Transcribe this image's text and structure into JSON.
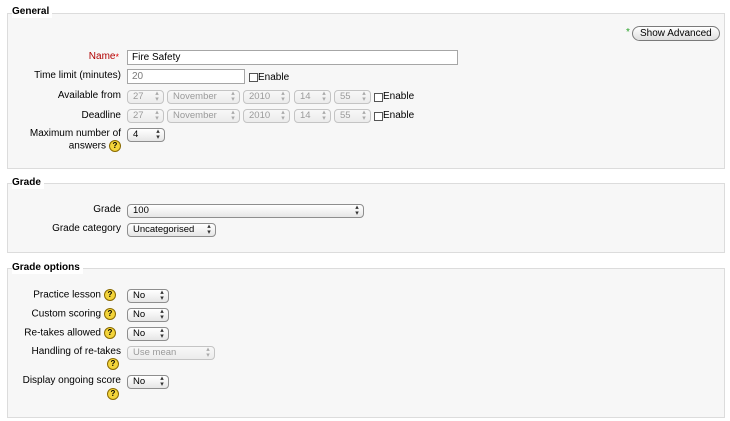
{
  "general": {
    "legend": "General",
    "show_advanced": "Show Advanced",
    "name_label": "Name",
    "name_value": "Fire Safety",
    "time_limit_label": "Time limit (minutes)",
    "time_limit_value": "20",
    "enable_label": "Enable",
    "available_from_label": "Available from",
    "deadline_label": "Deadline",
    "available_from": {
      "day": "27",
      "month": "November",
      "year": "2010",
      "hour": "14",
      "minute": "55"
    },
    "deadline": {
      "day": "27",
      "month": "November",
      "year": "2010",
      "hour": "14",
      "minute": "55"
    },
    "max_answers_label_1": "Maximum number of",
    "max_answers_label_2": "answers",
    "max_answers_value": "4"
  },
  "grade": {
    "legend": "Grade",
    "grade_label": "Grade",
    "grade_value": "100",
    "category_label": "Grade category",
    "category_value": "Uncategorised"
  },
  "grade_options": {
    "legend": "Grade options",
    "practice_label": "Practice lesson",
    "practice_value": "No",
    "custom_scoring_label": "Custom scoring",
    "custom_scoring_value": "No",
    "retakes_label": "Re-takes allowed",
    "retakes_value": "No",
    "handling_label": "Handling of re-takes",
    "handling_value": "Use mean",
    "ongoing_label": "Display ongoing score",
    "ongoing_value": "No"
  },
  "icons": {
    "help": "?",
    "required": "*",
    "advanced_marker": "*"
  }
}
